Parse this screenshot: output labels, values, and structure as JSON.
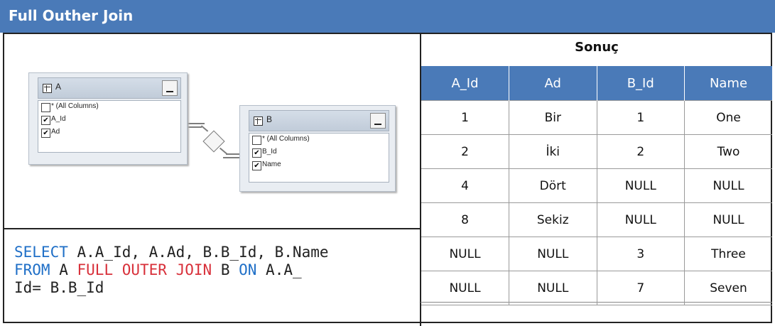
{
  "header": {
    "title": "Full Outher Join"
  },
  "diagram": {
    "table_a": {
      "name": "A",
      "columns": [
        {
          "label": "* (All Columns)",
          "checked": false
        },
        {
          "label": "A_Id",
          "checked": true
        },
        {
          "label": "Ad",
          "checked": true
        }
      ]
    },
    "table_b": {
      "name": "B",
      "columns": [
        {
          "label": "* (All Columns)",
          "checked": false
        },
        {
          "label": "B_Id",
          "checked": true
        },
        {
          "label": "Name",
          "checked": true
        }
      ]
    }
  },
  "sql": {
    "select_kw": "SELECT",
    "select_cols": " A.A_Id, A.Ad, B.B_Id, B.Name",
    "from_kw": "FROM",
    "from_table": " A ",
    "join_kw": "FULL OUTER JOIN",
    "join_table": " B ",
    "on_kw": "ON",
    "on_cond_1": " A.A_",
    "on_cond_2": "Id= B.B_Id"
  },
  "result": {
    "title": "Sonuç",
    "columns": [
      "A_Id",
      "Ad",
      "B_Id",
      "Name"
    ],
    "rows": [
      [
        "1",
        "Bir",
        "1",
        "One"
      ],
      [
        "2",
        "İki",
        "2",
        "Two"
      ],
      [
        "4",
        "Dört",
        "NULL",
        "NULL"
      ],
      [
        "8",
        "Sekiz",
        "NULL",
        "NULL"
      ],
      [
        "NULL",
        "NULL",
        "3",
        "Three"
      ],
      [
        "NULL",
        "NULL",
        "7",
        "Seven"
      ]
    ]
  }
}
